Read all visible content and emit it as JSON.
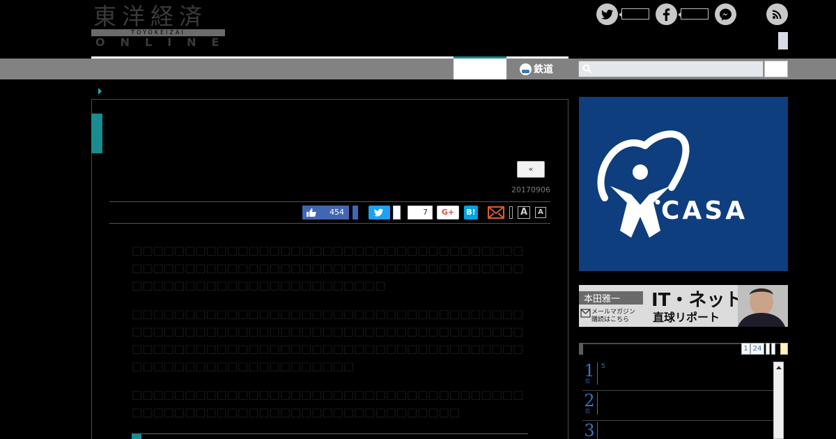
{
  "header": {
    "logo_kanji": "東洋経済",
    "logo_band": "TOYOKEIZAI",
    "logo_online": "ONLINE",
    "social": [
      {
        "name": "twitter"
      },
      {
        "name": "facebook"
      },
      {
        "name": "messenger"
      },
      {
        "name": "rss"
      }
    ]
  },
  "nav": {
    "rail_label": "鉄道",
    "search_placeholder": ""
  },
  "article": {
    "back_label": "«",
    "date": "20170906",
    "share": {
      "like_count": "454",
      "pocket_count": "7",
      "gplus_label": "G+",
      "hatena_label": "B!",
      "font_big": "A",
      "font_small": "A"
    },
    "paragraphs": [
      "□□□□□□□□□□□□□□□□□□□□□□□□□□□□□□□□□□□□□□□□□□□□□□□□□□□□□□□□□□□□□□□□□□□□□□□□□□□□□□□□□□□□□□□□□□□□□□□□□□",
      "□□□□□□□□□□□□□□□□□□□□□□□□□□□□□□□□□□□□□□□□□□□□□□□□□□□□□□□□□□□□□□□□□□□□□□□□□□□□□□□□□□□□□□□□□□□□□□□□□□□□□□□□□□□□□□□□□□□□□□□□□□□□□□□□□□□□",
      "□□□□□□□□□□□□□□□□□□□□□□□□□□□□□□□□□□□□□□□□□□□□□□□□□□□□□□□□□□□□□□□□□□□□"
    ]
  },
  "sidebar": {
    "ad_casa_label": "CASA",
    "banner": {
      "author": "本田雅一",
      "subscribe_line1": "メールマガジン",
      "subscribe_line2": "購読はこちら",
      "title": "IT・ネット",
      "subtitle": "直球リポート"
    },
    "ranking": {
      "tabs": [
        "1",
        "24"
      ],
      "rows": [
        {
          "rank": "1",
          "suffix": "位",
          "text": "5"
        },
        {
          "rank": "2",
          "suffix": "位",
          "text": ""
        },
        {
          "rank": "3",
          "suffix": "位",
          "text": ""
        }
      ]
    }
  },
  "colors": {
    "accent": "#1a8c91",
    "nav_bar": "#828282",
    "casa_blue": "#0e3e7e",
    "rank_blue": "#3476c0"
  }
}
